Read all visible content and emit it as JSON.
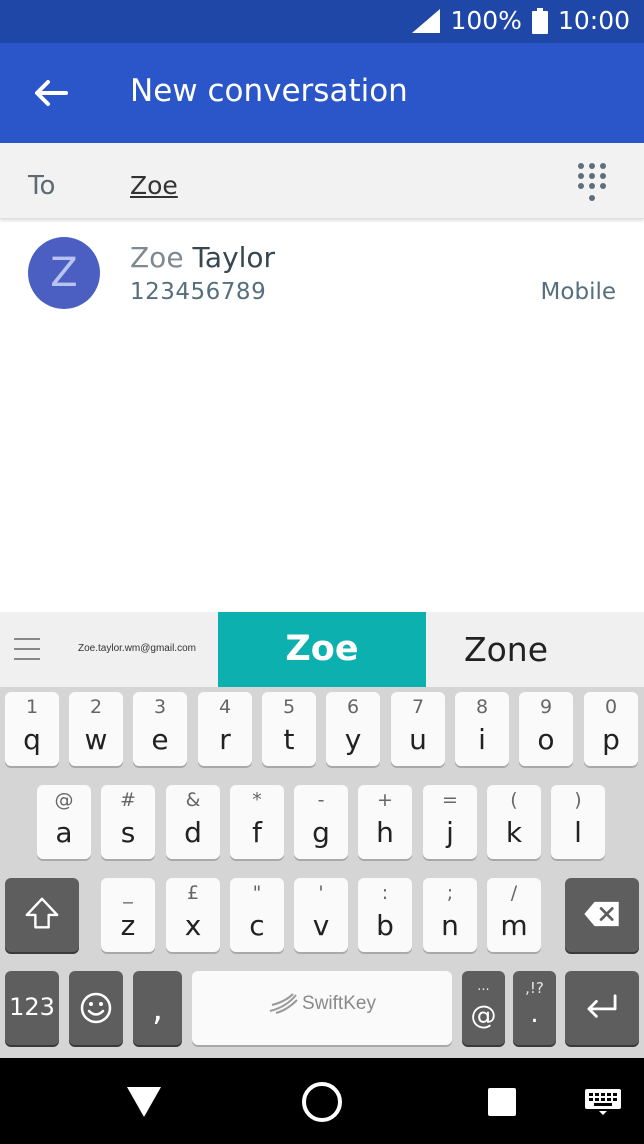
{
  "status_bar": {
    "battery_percent": "100%",
    "time": "10:00",
    "icons": [
      "signal-icon",
      "battery-icon"
    ]
  },
  "app_bar": {
    "title": "New conversation",
    "back_icon": "arrow-left-icon"
  },
  "recipient": {
    "label": "To",
    "value": "Zoe",
    "dialpad_icon": "dialpad-icon"
  },
  "contact_suggestion": {
    "avatar_letter": "Z",
    "name_match": "Zoe",
    "name_rest": " Taylor",
    "number": "123456789",
    "type": "Mobile"
  },
  "keyboard": {
    "suggestions": {
      "email": "Zoe.taylor.wm@gmail.com",
      "primary": "Zoe",
      "secondary": "Zone"
    },
    "row1": [
      {
        "hint": "1",
        "key": "q"
      },
      {
        "hint": "2",
        "key": "w"
      },
      {
        "hint": "3",
        "key": "e"
      },
      {
        "hint": "4",
        "key": "r"
      },
      {
        "hint": "5",
        "key": "t"
      },
      {
        "hint": "6",
        "key": "y"
      },
      {
        "hint": "7",
        "key": "u"
      },
      {
        "hint": "8",
        "key": "i"
      },
      {
        "hint": "9",
        "key": "o"
      },
      {
        "hint": "0",
        "key": "p"
      }
    ],
    "row2": [
      {
        "hint": "@",
        "key": "a"
      },
      {
        "hint": "#",
        "key": "s"
      },
      {
        "hint": "&",
        "key": "d"
      },
      {
        "hint": "*",
        "key": "f"
      },
      {
        "hint": "-",
        "key": "g"
      },
      {
        "hint": "+",
        "key": "h"
      },
      {
        "hint": "=",
        "key": "j"
      },
      {
        "hint": "(",
        "key": "k"
      },
      {
        "hint": ")",
        "key": "l"
      }
    ],
    "row3": [
      {
        "hint": "_",
        "key": "z"
      },
      {
        "hint": "£",
        "key": "x"
      },
      {
        "hint": "\"",
        "key": "c"
      },
      {
        "hint": "'",
        "key": "v"
      },
      {
        "hint": ":",
        "key": "b"
      },
      {
        "hint": ";",
        "key": "n"
      },
      {
        "hint": "/",
        "key": "m"
      }
    ],
    "bottom": {
      "numbers_label": "123",
      "comma": ",",
      "space_brand": "SwiftKey",
      "at_hint": "...",
      "at_key": "@",
      "period_hint": ",!?",
      "period_key": "."
    }
  },
  "nav_bar": {
    "icons": [
      "nav-back-icon",
      "nav-home-icon",
      "nav-recents-icon",
      "keyboard-icon"
    ]
  }
}
